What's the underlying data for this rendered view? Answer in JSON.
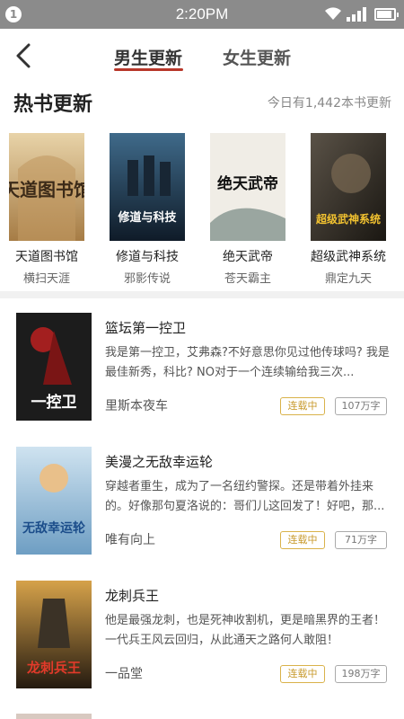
{
  "status_bar": {
    "notification": "1",
    "time": "2:20PM"
  },
  "header": {
    "tab_men": "男生更新",
    "tab_women": "女生更新"
  },
  "hot": {
    "title": "热书更新",
    "count_text": "今日有1,442本书更新",
    "books": [
      {
        "title": "天道图书馆",
        "author": "横扫天涯",
        "cover_text": "天道图书馆",
        "cover_color": "#c9a36b"
      },
      {
        "title": "修道与科技",
        "author": "邪影传说",
        "cover_text": "修道与科技",
        "cover_color": "#1f3a55"
      },
      {
        "title": "绝天武帝",
        "author": "苍天霸主",
        "cover_text": "绝天武帝",
        "cover_color": "#e7e2d8"
      },
      {
        "title": "超级武神系统",
        "author": "鼎定九天",
        "cover_text": "超级武神系统",
        "cover_color": "#2a2620"
      }
    ]
  },
  "list": [
    {
      "title": "篮坛第一控卫",
      "desc": "我是第一控卫，艾弗森?不好意思你见过他传球吗? 我是最佳新秀，科比? NO对于一个连续输给我三次...",
      "author": "里斯本夜车",
      "status": "连载中",
      "words": "107万字",
      "cover_text": "一控卫",
      "cover_color": "#8a1c1c"
    },
    {
      "title": "美漫之无敌幸运轮",
      "desc": "穿越者重生，成为了一名纽约警探。还是带着外挂来的。好像那句夏洛说的：哥们儿这回发了！好吧，那...",
      "author": "唯有向上",
      "status": "连载中",
      "words": "71万字",
      "cover_text": "无敌幸运轮",
      "cover_color": "#9cc3e0"
    },
    {
      "title": "龙刺兵王",
      "desc": "他是最强龙刺，也是死神收割机，更是暗黑界的王者！一代兵王风云回归，从此通天之路何人敢阻！",
      "author": "一品堂",
      "status": "连载中",
      "words": "198万字",
      "cover_text": "龙刺兵王",
      "cover_color": "#3a2a1a"
    }
  ]
}
